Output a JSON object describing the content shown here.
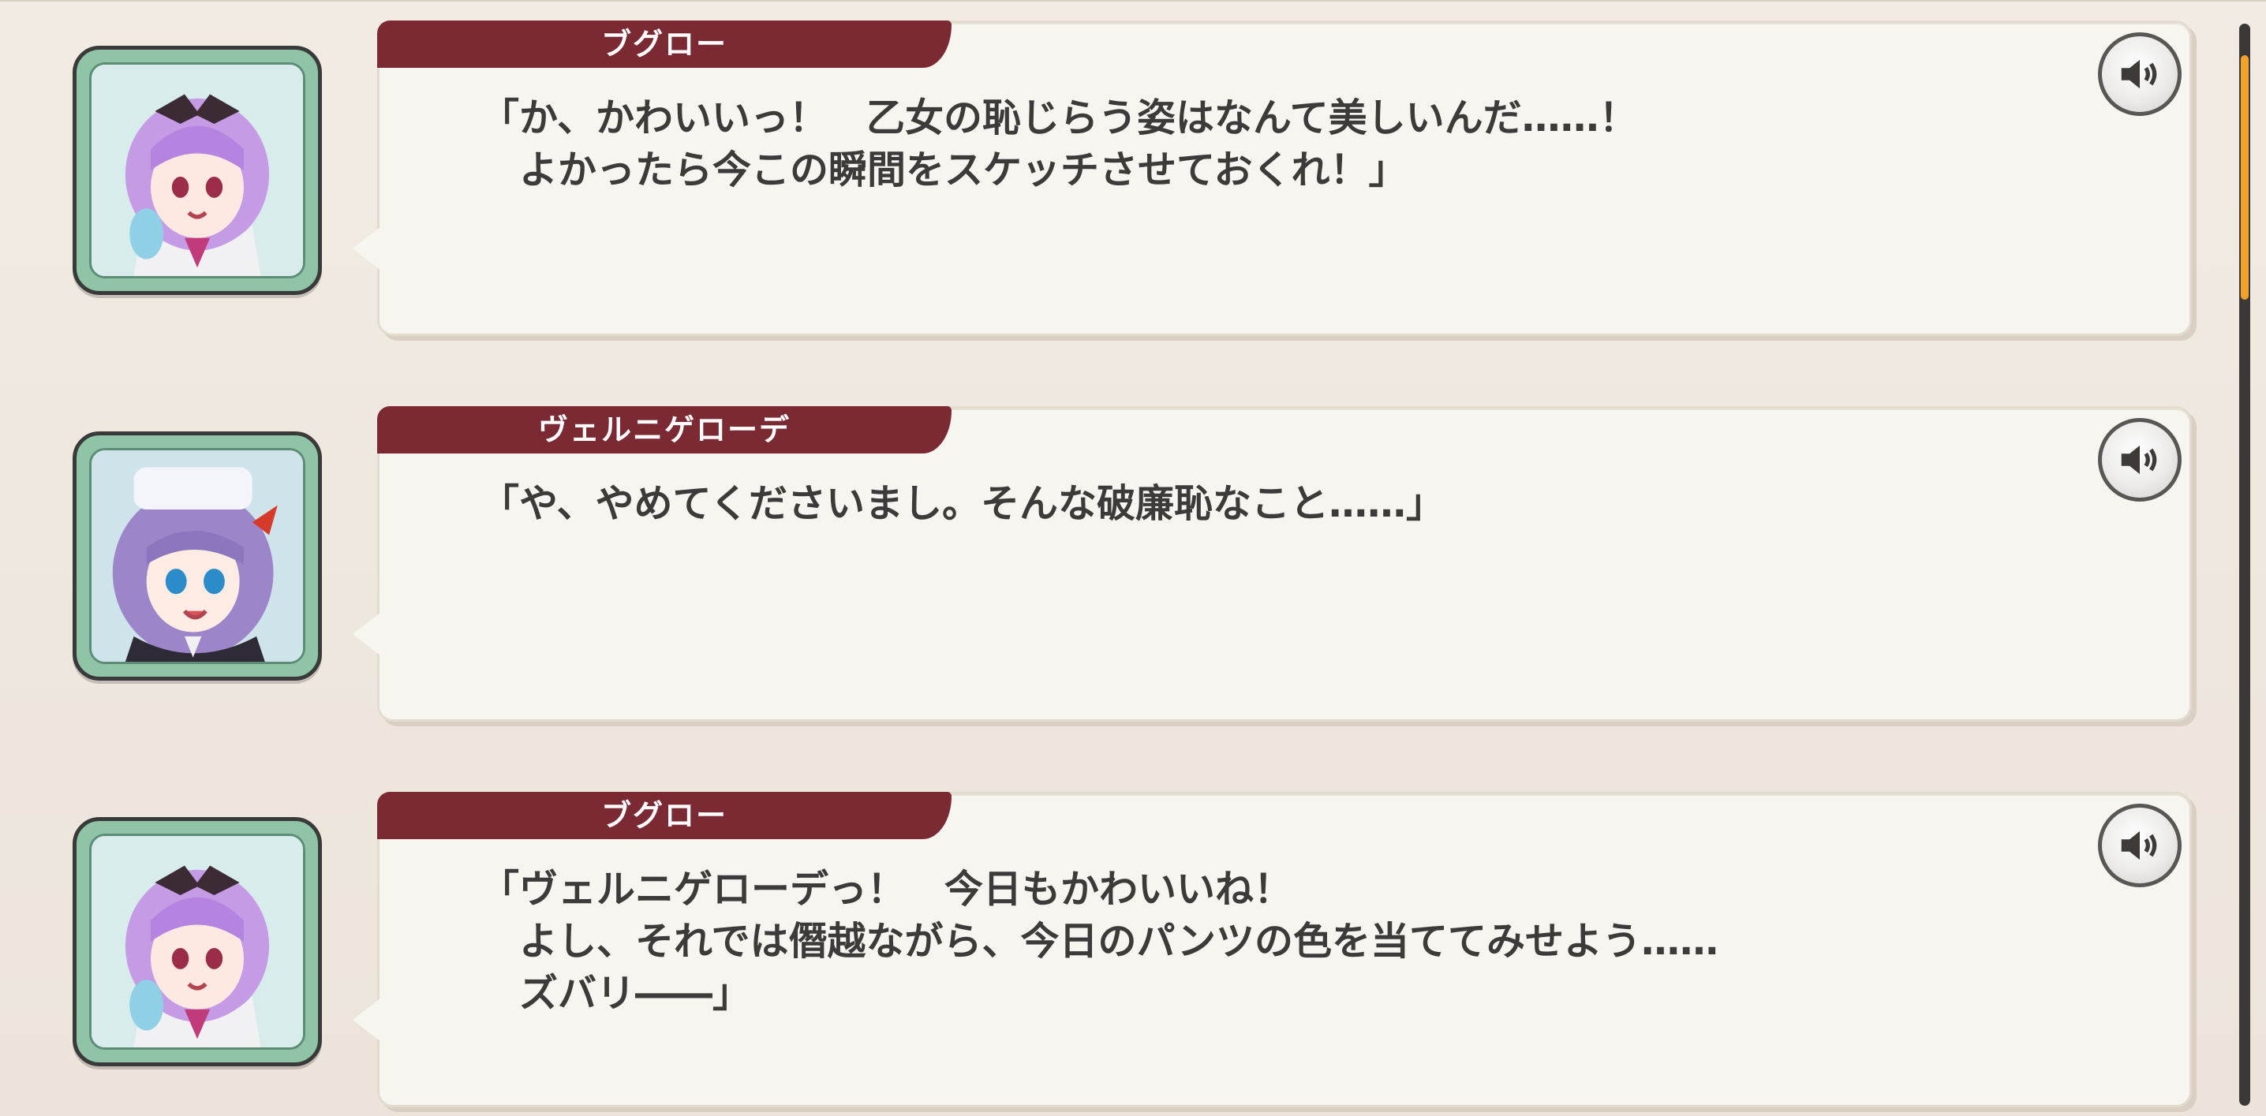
{
  "entries": [
    {
      "speaker": "ブグロー",
      "line": "「か、かわいいっ！　乙女の恥じらう姿はなんて美しいんだ……！\n　よかったら今この瞬間をスケッチさせておくれ！」",
      "portrait_icon": "character-portrait-bouguereau"
    },
    {
      "speaker": "ヴェルニゲローデ",
      "line": "「や、やめてくださいまし。そんな破廉恥なこと……」",
      "portrait_icon": "character-portrait-wernigerode"
    },
    {
      "speaker": "ブグロー",
      "line": "「ヴェルニゲローデっ！　今日もかわいいね！\n　よし、それでは僭越ながら、今日のパンツの色を当ててみせよう……\n　ズバリ――」",
      "portrait_icon": "character-portrait-bouguereau"
    }
  ],
  "icons": {
    "voice": "speaker-volume-icon"
  },
  "colors": {
    "name_tab": "#7b2a34",
    "bubble": "#f7f5f0",
    "portrait_frame": "#8fc4a6",
    "scroll_thumb": "#f0a22a",
    "background": "#efe8df"
  },
  "scroll": {
    "position": 0.0
  }
}
